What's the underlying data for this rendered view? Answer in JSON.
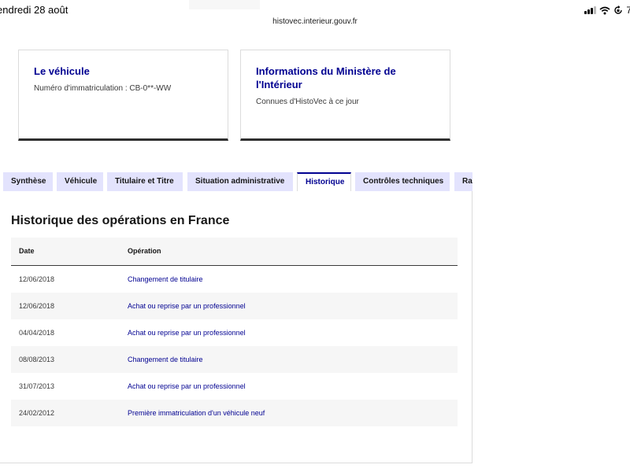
{
  "status_bar": {
    "time": "endredi 28 août",
    "battery": "7",
    "url": "histovec.interieur.gouv.fr"
  },
  "cards": {
    "vehicle": {
      "title": "Le véhicule",
      "text": "Numéro d'immatriculation : CB-0**-WW"
    },
    "ministry": {
      "title": "Informations du Ministère de l'Intérieur",
      "text": "Connues d'HistoVec à ce jour"
    }
  },
  "tabs": [
    {
      "label": "Synthèse",
      "active": false
    },
    {
      "label": "Véhicule",
      "active": false
    },
    {
      "label": "Titulaire et Titre",
      "active": false
    },
    {
      "label": "Situation administrative",
      "active": false
    },
    {
      "label": "Historique",
      "active": true
    },
    {
      "label": "Contrôles techniques",
      "active": false
    },
    {
      "label": "Rap",
      "active": false
    }
  ],
  "history": {
    "title": "Historique des opérations en France",
    "columns": [
      "Date",
      "Opération"
    ],
    "rows": [
      {
        "date": "12/06/2018",
        "operation": "Changement de titulaire"
      },
      {
        "date": "12/06/2018",
        "operation": "Achat ou reprise par un professionnel"
      },
      {
        "date": "04/04/2018",
        "operation": "Achat ou reprise par un professionnel"
      },
      {
        "date": "08/08/2013",
        "operation": "Changement de titulaire"
      },
      {
        "date": "31/07/2013",
        "operation": "Achat ou reprise par un professionnel"
      },
      {
        "date": "24/02/2012",
        "operation": "Première immatriculation d'un véhicule neuf"
      }
    ]
  },
  "colors": {
    "primary_blue": "#000091",
    "tab_background": "#e3e3fd",
    "row_stripe": "#f6f6f6"
  }
}
